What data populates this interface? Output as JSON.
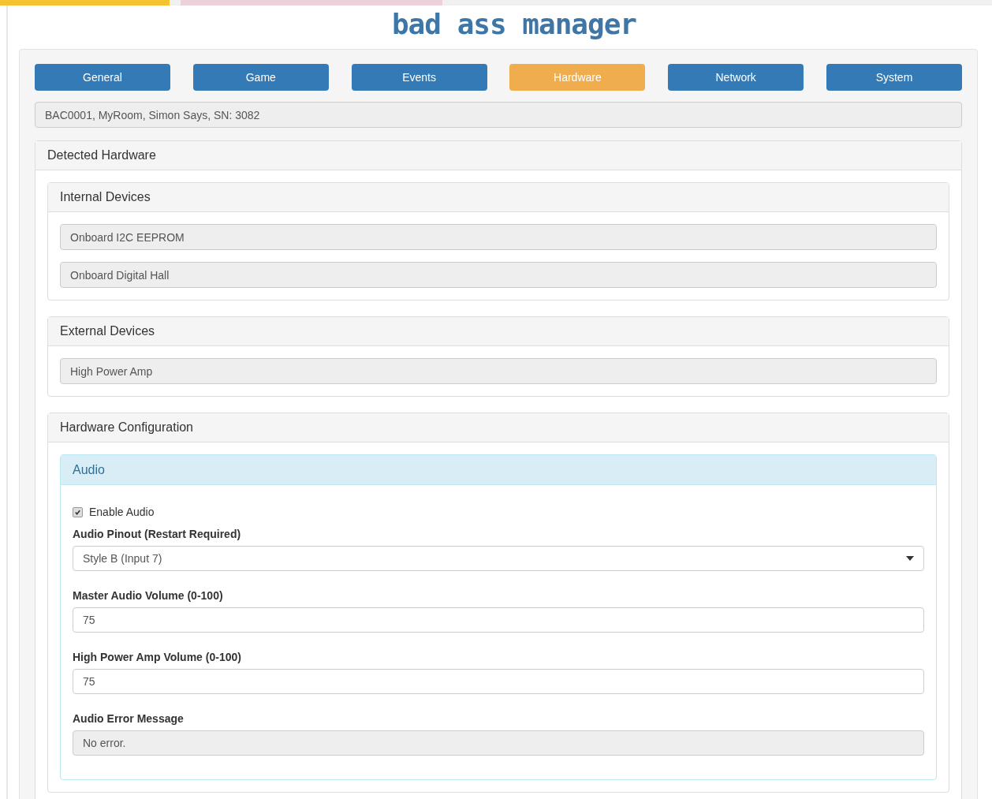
{
  "logo": "bad ass manager",
  "tabs": [
    {
      "label": "General",
      "selected": false
    },
    {
      "label": "Game",
      "selected": false
    },
    {
      "label": "Events",
      "selected": false
    },
    {
      "label": "Hardware",
      "selected": true
    },
    {
      "label": "Network",
      "selected": false
    },
    {
      "label": "System",
      "selected": false
    }
  ],
  "device_info": "BAC0001, MyRoom, Simon Says, SN: 3082",
  "detected_hardware": {
    "title": "Detected Hardware",
    "groups": [
      {
        "title": "Internal Devices",
        "devices": [
          "Onboard I2C EEPROM",
          "Onboard Digital Hall"
        ]
      },
      {
        "title": "External Devices",
        "devices": [
          "High Power Amp"
        ]
      }
    ]
  },
  "hardware_configuration": {
    "title": "Hardware Configuration",
    "audio": {
      "title": "Audio",
      "enable": {
        "label": "Enable Audio",
        "checked": true
      },
      "fields": [
        {
          "kind": "select",
          "label": "Audio Pinout (Restart Required)",
          "value": "Style B (Input 7)"
        },
        {
          "kind": "input",
          "label": "Master Audio Volume (0-100)",
          "value": "75"
        },
        {
          "kind": "input",
          "label": "High Power Amp Volume (0-100)",
          "value": "75"
        },
        {
          "kind": "readonly",
          "label": "Audio Error Message",
          "value": "No error."
        }
      ]
    }
  }
}
